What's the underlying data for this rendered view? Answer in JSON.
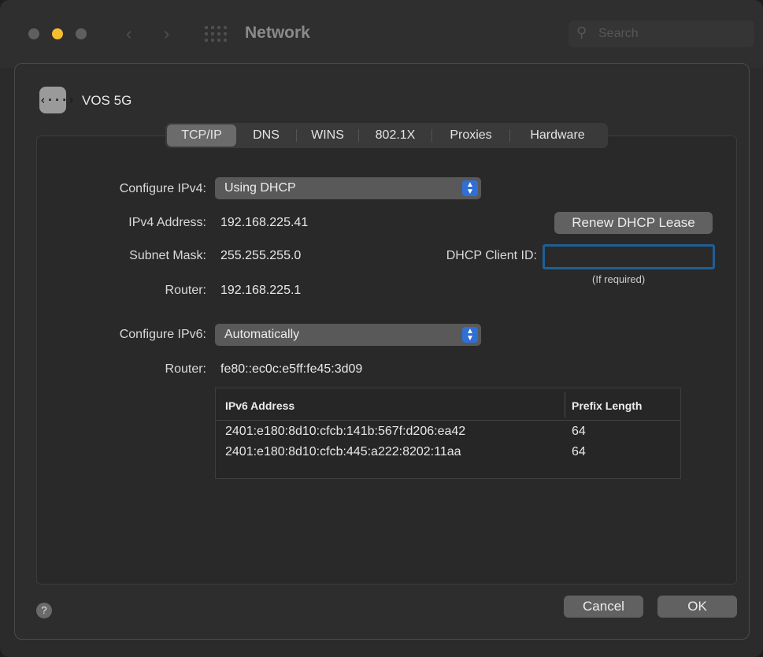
{
  "window": {
    "title": "Network",
    "search_placeholder": "Search"
  },
  "service": {
    "icon": "ethernet-arrows-icon",
    "icon_glyph": "‹···›",
    "name": "VOS 5G"
  },
  "tabs": [
    {
      "label": "TCP/IP",
      "active": true
    },
    {
      "label": "DNS",
      "active": false
    },
    {
      "label": "WINS",
      "active": false
    },
    {
      "label": "802.1X",
      "active": false
    },
    {
      "label": "Proxies",
      "active": false
    },
    {
      "label": "Hardware",
      "active": false
    }
  ],
  "ipv4": {
    "configure_label": "Configure IPv4:",
    "configure_value": "Using DHCP",
    "address_label": "IPv4 Address:",
    "address_value": "192.168.225.41",
    "subnet_label": "Subnet Mask:",
    "subnet_value": "255.255.255.0",
    "router_label": "Router:",
    "router_value": "192.168.225.1",
    "renew_button": "Renew DHCP Lease",
    "client_id_label": "DHCP Client ID:",
    "client_id_value": "",
    "client_id_hint": "(If required)"
  },
  "ipv6": {
    "configure_label": "Configure IPv6:",
    "configure_value": "Automatically",
    "router_label": "Router:",
    "router_value": "fe80::ec0c:e5ff:fe45:3d09",
    "table_headers": [
      "IPv6 Address",
      "Prefix Length"
    ],
    "rows": [
      {
        "address": "2401:e180:8d10:cfcb:141b:567f:d206:ea42",
        "prefix": "64"
      },
      {
        "address": "2401:e180:8d10:cfcb:445:a222:8202:11aa",
        "prefix": "64"
      }
    ]
  },
  "footer": {
    "help_glyph": "?",
    "cancel_label": "Cancel",
    "ok_label": "OK"
  },
  "colors": {
    "accent_blue": "#2f6fd6",
    "focus_ring": "#1f5f95",
    "minimize_yellow": "#f6be2e"
  }
}
